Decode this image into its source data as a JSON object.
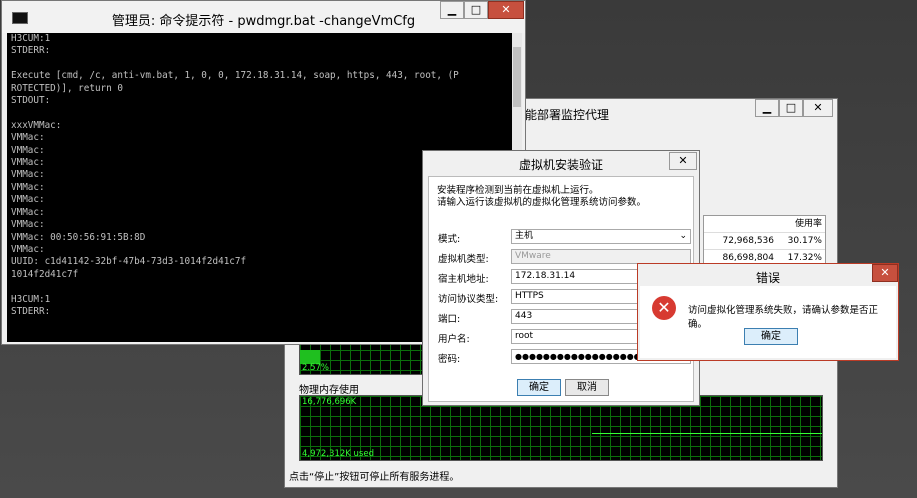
{
  "cmd": {
    "title": "管理员: 命令提示符 - pwdmgr.bat  -changeVmCfg",
    "lines": [
      "H3CUM:1",
      "STDERR:",
      "",
      "Execute [cmd, /c, anti-vm.bat, 1, 0, 0, 172.18.31.14, soap, https, 443, root, (P",
      "ROTECTED)], return 0",
      "STDOUT:",
      "",
      "xxxVMMac:",
      "VMMac:",
      "VMMac:",
      "VMMac:",
      "VMMac:",
      "VMMac:",
      "VMMac:",
      "VMMac:",
      "VMMac:",
      "VMMac: 00:50:56:91:5B:8D",
      "VMMac:",
      "UUID: c1d41142-32bf-47b4-73d3-1014f2d41c7f",
      "1014f2d41c7f",
      "",
      "H3CUM:1",
      "STDERR:"
    ]
  },
  "agent": {
    "title": "能部署监控代理",
    "table": {
      "header": [
        "",
        "使用率"
      ],
      "rows": [
        [
          "72,968,536",
          "30.17%"
        ],
        [
          "86,698,804",
          "17.32%"
        ]
      ]
    },
    "cpu_graph_label": "2.57%",
    "mem_section_title": "物理内存使用",
    "mem_total": "16,776,696K",
    "mem_used": "4,972,312K used",
    "status_text": "点击“停止”按钮可停止所有服务进程。"
  },
  "install_dialog": {
    "title": "虚拟机安装验证",
    "intro_line1": "安装程序检测到当前在虚拟机上运行。",
    "intro_line2": "请输入运行该虚拟机的虚拟化管理系统访问参数。",
    "mode_label": "模式:",
    "mode_value": "主机",
    "vm_type_label": "虚拟机类型:",
    "vm_type_value": "VMware",
    "host_label": "宿主机地址:",
    "host_value": "172.18.31.14",
    "protocol_label": "访问协议类型:",
    "protocol_value": "HTTPS",
    "port_label": "端口:",
    "port_value": "443",
    "user_label": "用户名:",
    "user_value": "root",
    "password_label": "密码:",
    "password_value": "●●●●●●●●●●●●●●●●●●",
    "ok_label": "确定",
    "cancel_label": "取消"
  },
  "error_dialog": {
    "title": "错误",
    "message": "访问虚拟化管理系统失败，请确认参数是否正确。",
    "ok_label": "确定"
  }
}
